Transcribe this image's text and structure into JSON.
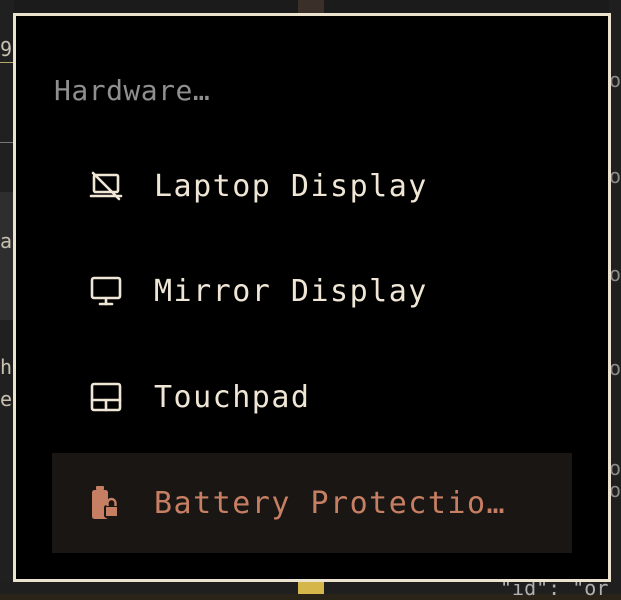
{
  "background": {
    "left_fragments": [
      "9",
      "a",
      "h",
      "e"
    ],
    "right_fragments": [
      "or",
      "or",
      "or",
      "or",
      "or",
      "or"
    ],
    "bottom_fragment": "\"id\": \"or"
  },
  "menu": {
    "title": "Hardware…",
    "items": [
      {
        "label": "Laptop Display",
        "icon": "laptop-display-off-icon",
        "selected": false
      },
      {
        "label": "Mirror Display",
        "icon": "monitor-icon",
        "selected": false
      },
      {
        "label": "Touchpad",
        "icon": "touchpad-icon",
        "selected": false
      },
      {
        "label": "Battery Protectio…",
        "icon": "battery-lock-icon",
        "selected": true
      }
    ]
  },
  "colors": {
    "popup_background": "#000000",
    "popup_border": "#ece3cf",
    "text": "#efe6d6",
    "title": "#8f8f8f",
    "selected_text": "#c77f63",
    "selected_background": "#191614"
  }
}
